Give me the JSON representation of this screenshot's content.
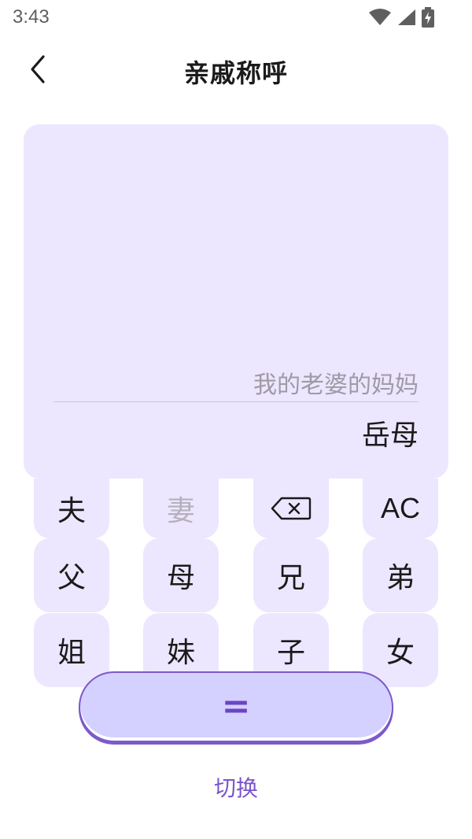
{
  "status_bar": {
    "time": "3:43",
    "icons": [
      "wifi-icon",
      "signal-icon",
      "battery-charging-icon"
    ]
  },
  "header": {
    "title": "亲戚称呼",
    "back_icon": "chevron-left-icon"
  },
  "display": {
    "expression": "我的老婆的妈妈",
    "result": "岳母"
  },
  "keypad": {
    "row1": {
      "husband": "夫",
      "wife": "妻",
      "backspace_icon": "backspace-icon",
      "clear": "AC"
    },
    "row2": {
      "father": "父",
      "mother": "母",
      "elder_brother": "兄",
      "younger_brother": "弟"
    },
    "row3": {
      "elder_sister": "姐",
      "younger_sister": "妹",
      "son": "子",
      "daughter": "女"
    },
    "equals": "="
  },
  "switch_label": "切换",
  "colors": {
    "panel": "#ede6ff",
    "accent": "#7a55c9",
    "equals_fill": "#d4d0ff",
    "disabled_key": "#b5b0bd"
  }
}
